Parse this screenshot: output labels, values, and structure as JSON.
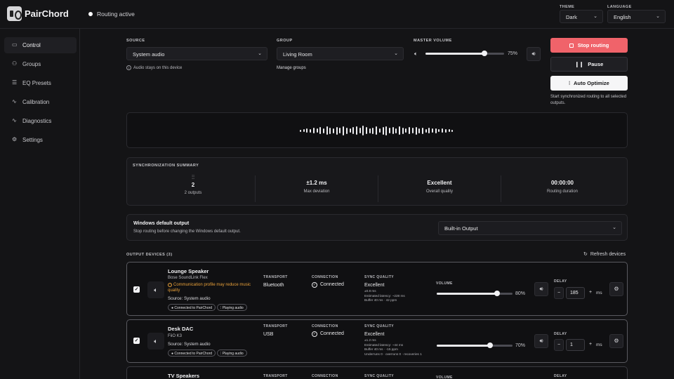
{
  "app": {
    "name": "PairChord",
    "status": "Routing active"
  },
  "theme": {
    "label": "THEME",
    "value": "Dark"
  },
  "language": {
    "label": "LANGUAGE",
    "value": "English"
  },
  "sidebar": {
    "items": [
      {
        "label": "Control",
        "icon": "monitor-icon",
        "active": true
      },
      {
        "label": "Groups",
        "icon": "users-icon"
      },
      {
        "label": "EQ Presets",
        "icon": "sliders-icon"
      },
      {
        "label": "Calibration",
        "icon": "activity-icon"
      },
      {
        "label": "Diagnostics",
        "icon": "pulse-icon"
      },
      {
        "label": "Settings",
        "icon": "gear-icon"
      }
    ]
  },
  "source": {
    "label": "SOURCE",
    "value": "System audio",
    "note": "Audio stays on this device"
  },
  "group": {
    "label": "GROUP",
    "value": "Living Room",
    "manage": "Manage groups"
  },
  "master": {
    "label": "MASTER VOLUME",
    "value": 75,
    "display": "75%"
  },
  "actions": {
    "stop": "Stop routing",
    "pause": "Pause",
    "auto": "Auto Optimize",
    "helper": "Start synchronized routing to all selected outputs."
  },
  "summary": {
    "title": "SYNCHRONIZATION SUMMARY",
    "outputs_value": "2",
    "outputs_label": "2 outputs",
    "deviation_value": "±1.2 ms",
    "deviation_label": "Max deviation",
    "quality_value": "Excellent",
    "quality_label": "Overall quality",
    "duration_value": "00:00:00",
    "duration_label": "Routing duration"
  },
  "windows_default": {
    "title": "Windows default output",
    "desc": "Stop routing before changing the Windows default output.",
    "value": "Built-in Output"
  },
  "outputs": {
    "title": "OUTPUT DEVICES (3)",
    "refresh": "Refresh devices"
  },
  "column_labels": {
    "transport": "TRANSPORT",
    "connection": "CONNECTION",
    "sync": "SYNC QUALITY",
    "volume": "VOLUME",
    "delay": "DELAY",
    "ms": "ms"
  },
  "devices": [
    {
      "name": "Lounge Speaker",
      "model": "Bose SoundLink Flex",
      "warning": "Communication profile may reduce music quality",
      "source": "Source: System audio",
      "pill_connected": "Connected to PairChord",
      "pill_playing": "Playing audio",
      "transport": "Bluetooth",
      "connection": "Connected",
      "sync": "Excellent",
      "sync_detail_1": "±0.8 ms",
      "sync_detail_2": "Estimated latency: ~228 ms",
      "sync_detail_3": "Buffer 40 ms · 42 ppm",
      "volume": 80,
      "volume_display": "80%",
      "delay": "185",
      "checked": true
    },
    {
      "name": "Desk DAC",
      "model": "FiiO K3",
      "source": "Source: System audio",
      "pill_connected": "Connected to PairChord",
      "pill_playing": "Playing audio",
      "transport": "USB",
      "connection": "Connected",
      "sync": "Excellent",
      "sync_detail_1": "±1.2 ms",
      "sync_detail_2": "Estimated latency: ~44 ms",
      "sync_detail_3": "Buffer 40 ms · -15 ppm",
      "sync_detail_4": "Underruns 0 · overruns 0 · recoveries 1",
      "volume": 70,
      "volume_display": "70%",
      "delay": "1",
      "checked": true
    },
    {
      "name": "TV Speakers",
      "transport_label": "TRANSPORT"
    }
  ],
  "colors": {
    "accent_danger": "#f0636a",
    "warning": "#e9a13a",
    "background": "#141416"
  }
}
